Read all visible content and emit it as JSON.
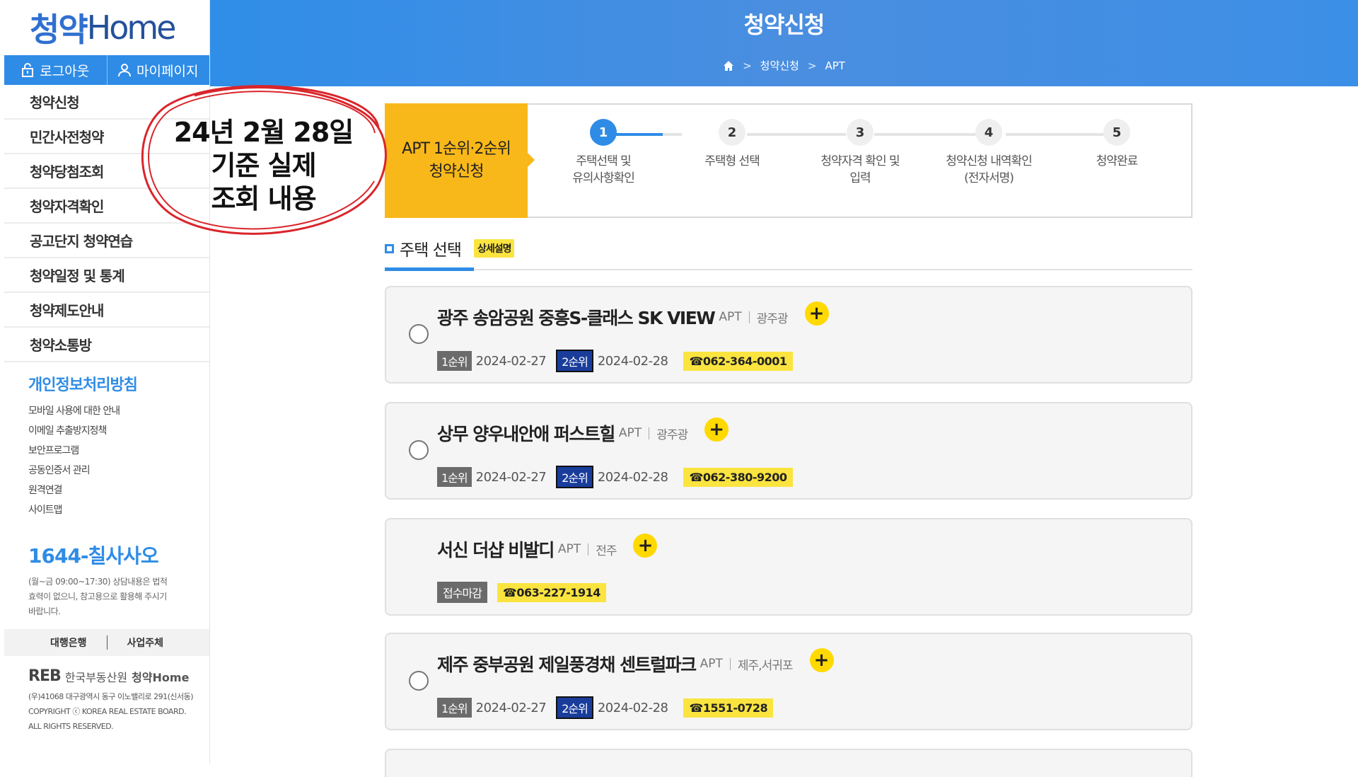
{
  "sidebar": {
    "logo_main": "청약",
    "logo_home": "Home",
    "logout_label": "로그아웃",
    "mypage_label": "마이페이지",
    "menu": [
      "청약신청",
      "민간사전청약",
      "청약당첨조회",
      "청약자격확인",
      "공고단지 청약연습",
      "청약일정 및 통계",
      "청약제도안내",
      "청약소통방"
    ],
    "privacy_title": "개인정보처리방침",
    "sub_links": [
      "모바일 사용에 대한 안내",
      "이메일 추출방지정책",
      "보안프로그램",
      "공동인증서 관리",
      "원격연결",
      "사이트맵"
    ],
    "phone": "1644-칠사사오",
    "phone_note": "(월~금 09:00~17:30) 상담내용은 법적효력이 없으니, 참고용으로 활용해 주시기 바랍니다.",
    "bank_label": "대행은행",
    "business_label": "사업주체",
    "footer_reb": "REB",
    "footer_org": "한국부동산원",
    "footer_brand": "청약Home",
    "footer_address": "(우)41068 대구광역시 동구 이노밸리로 291(신서동)",
    "footer_copyright": "COPYRIGHT ⓒ KOREA REAL ESTATE BOARD.",
    "footer_rights": "ALL RIGHTS RESERVED."
  },
  "header": {
    "title": "청약신청",
    "breadcrumb": [
      "청약신청",
      "APT"
    ]
  },
  "annotation": {
    "line1": "24년 2월 28일",
    "line2": "기준 실제",
    "line3": "조회 내용",
    "color": "#d9252b"
  },
  "stepper": {
    "current_line1": "APT 1순위·2순위",
    "current_line2": "청약신청",
    "steps": [
      {
        "num": "1",
        "line1": "주택선택 및",
        "line2": "유의사항확인"
      },
      {
        "num": "2",
        "line1": "주택형 선택",
        "line2": ""
      },
      {
        "num": "3",
        "line1": "청약자격 확인 및",
        "line2": "입력"
      },
      {
        "num": "4",
        "line1": "청약신청 내역확인",
        "line2": "(전자서명)"
      },
      {
        "num": "5",
        "line1": "청약완료",
        "line2": ""
      }
    ]
  },
  "section": {
    "title": "주택 선택",
    "badge": "상세설명"
  },
  "listings": [
    {
      "name": "광주 송암공원 중흥S-클래스 SK VIEW",
      "type": "APT",
      "region": "광주광",
      "rank1": "1순위",
      "date1": "2024-02-27",
      "rank2": "2순위",
      "date2": "2024-02-28",
      "phone": "☎062-364-0001"
    },
    {
      "name": "상무 양우내안애 퍼스트힐",
      "type": "APT",
      "region": "광주광",
      "rank1": "1순위",
      "date1": "2024-02-27",
      "rank2": "2순위",
      "date2": "2024-02-28",
      "phone": "☎062-380-9200"
    },
    {
      "name": "서신 더샵 비발디",
      "type": "APT",
      "region": "전주",
      "closed": "접수마감",
      "phone": "☎063-227-1914"
    },
    {
      "name": "제주 중부공원 제일풍경채 센트럴파크",
      "type": "APT",
      "region": "제주,서귀포",
      "rank1": "1순위",
      "date1": "2024-02-27",
      "rank2": "2순위",
      "date2": "2024-02-28",
      "phone": "☎1551-0728"
    }
  ],
  "colors": {
    "primary": "#2f8ce6",
    "accent_yellow": "#f9b819",
    "tag_yellow": "#fbe43f",
    "rank2_blue": "#1a3d9c"
  },
  "plus_symbol": "+"
}
